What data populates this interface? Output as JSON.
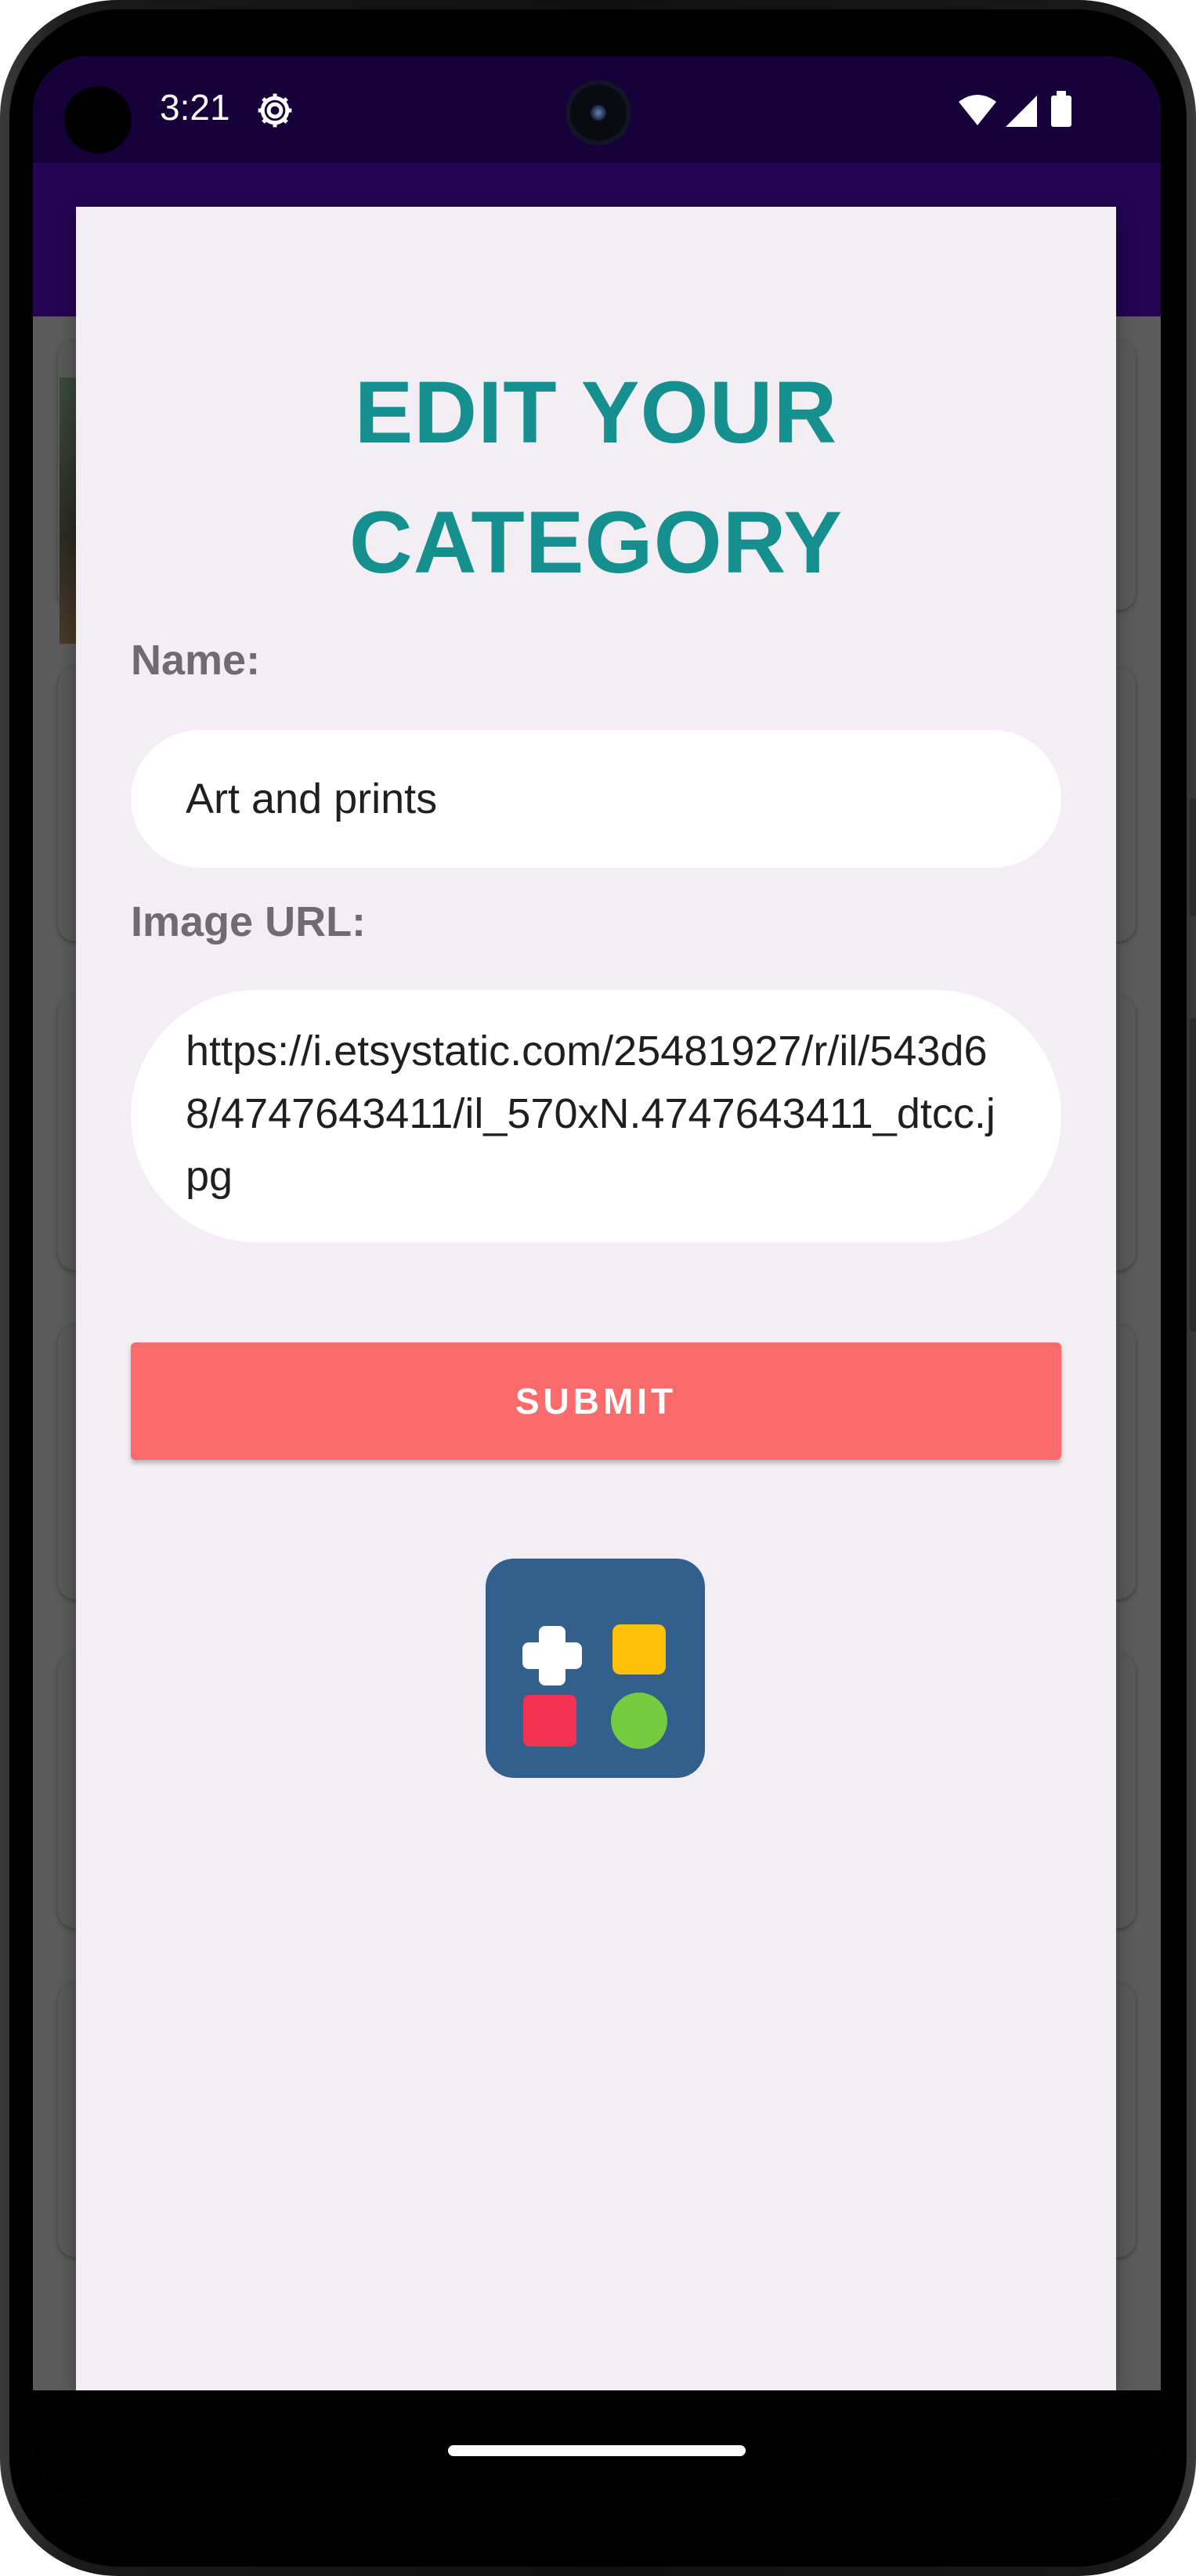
{
  "status_bar": {
    "time": "3:21",
    "icons": [
      "gear-icon",
      "wifi-icon",
      "signal-icon",
      "battery-icon"
    ]
  },
  "dialog": {
    "title_line1": "EDIT YOUR",
    "title_line2": "CATEGORY",
    "name_label": "Name:",
    "name_value": "Art and prints",
    "image_url_label": "Image URL:",
    "image_url_value": "https://i.etsystatic.com/25481927/r/il/543d68/4747643411/il_570xN.4747643411_dtcc.jpg",
    "submit_label": "SUBMIT",
    "logo_icon": "app-logo-icon"
  },
  "colors": {
    "title": "#168f8f",
    "submit": "#fc6b6b",
    "status_bar": "#17013a",
    "app_bar": "#240453",
    "dialog_bg": "#f2eef3",
    "logo_bg": "#335f8c"
  }
}
